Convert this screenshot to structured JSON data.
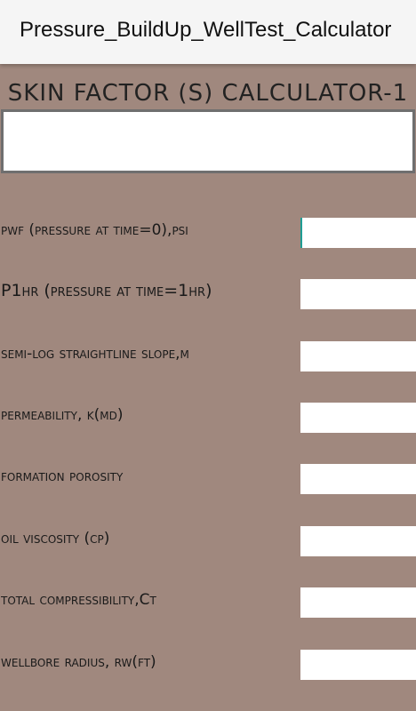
{
  "appbar": {
    "title": "Pressure_BuildUp_WellTest_Calculator"
  },
  "heading": "SKIN FACTOR (S) CALCULATOR-1",
  "result": {
    "value": ""
  },
  "inputs": [
    {
      "label": "pwf (pressure at time=0),psi",
      "value": ""
    },
    {
      "label": "P1hr (pressure at time=1hr)",
      "value": ""
    },
    {
      "label": "semi-log straightline slope,m",
      "value": ""
    },
    {
      "label": "permeability, k(md)",
      "value": ""
    },
    {
      "label": "formation porosity",
      "value": ""
    },
    {
      "label": "oil viscosity (cp)",
      "value": ""
    },
    {
      "label": "total compressibility,Ct",
      "value": ""
    },
    {
      "label": "wellbore radius, rw(ft)",
      "value": ""
    }
  ]
}
